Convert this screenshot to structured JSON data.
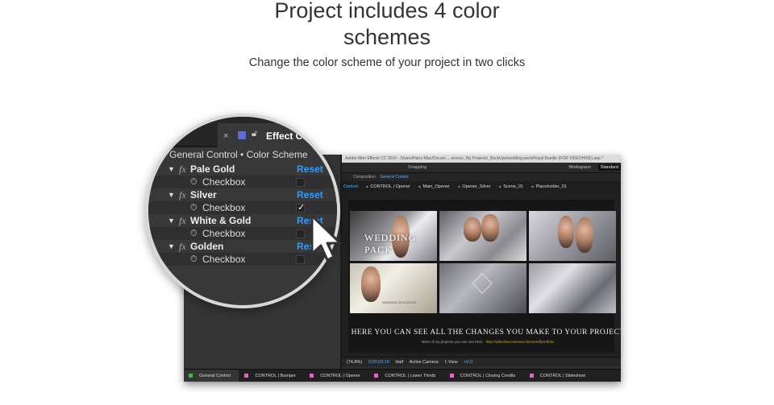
{
  "header": {
    "title_line1": "Project includes 4 color",
    "title_line2": "schemes",
    "subtitle": "Change the color scheme of your project in two clicks"
  },
  "app": {
    "window_title": "Adobe After Effects CC 2014 - /Users/Harry-Mac/Docum ... erence_My Projects/_BackUps/wedding pack/Royal Bundle (FOR VIDEOHIVE).aep *",
    "snapping_label": "Snapping",
    "workspace_label": "Workspace:",
    "workspace_value": "Standard",
    "composition_tab": "Composition",
    "composition_name": "General Control",
    "breadcrumbs": [
      "Control",
      "CONTROL | Opener",
      "Main_Opener",
      "Opener_Silver",
      "Scene_01",
      "Placeholder_01"
    ],
    "preview": {
      "tile1_text": "WEDDING PACK",
      "tile4_text": "WEDDING INVITATION",
      "headline": "HERE YOU CAN SEE ALL THE CHANGES YOU MAKE TO YOUR PROJECT",
      "more_text": "More of my projects you can see here:",
      "more_url": "http://videohive.net/user/Jarvisred/portfolio"
    },
    "footer": {
      "zoom": "(74,8%)",
      "timecode": "0;00;03;15",
      "resolution": "Half",
      "camera": "Active Camera",
      "view": "1 View",
      "exposure": "+0,0"
    },
    "timeline_tabs": [
      {
        "label": "General Control",
        "color": "#4caf50"
      },
      {
        "label": "CONTROL | Bumper",
        "color": "#e066c0"
      },
      {
        "label": "CONTROL | Opener",
        "color": "#e066c0"
      },
      {
        "label": "CONTROL | Lower Thirds",
        "color": "#e066c0"
      },
      {
        "label": "CONTROL | Closing Credits",
        "color": "#e066c0"
      },
      {
        "label": "CONTROL | Slideshow",
        "color": "#e066c0"
      }
    ]
  },
  "effects_panel": {
    "tab_partial": "ect",
    "tab_label": "Effect Controls",
    "tab_swatch_color": "#5b6bd8",
    "heading": "General Control • Color Scheme",
    "effects": [
      {
        "name": "Pale Gold",
        "reset": "Reset",
        "checkbox_label": "Checkbox",
        "checked": false
      },
      {
        "name": "Silver",
        "reset": "Reset",
        "checkbox_label": "Checkbox",
        "checked": true
      },
      {
        "name": "White & Gold",
        "reset": "Reset",
        "checkbox_label": "Checkbox",
        "checked": false
      },
      {
        "name": "Golden",
        "reset": "Reset",
        "checkbox_label": "Checkbox",
        "checked": false
      }
    ]
  },
  "icons": {
    "fx": "fx",
    "stopwatch": "stopwatch-icon",
    "expand": "triangle-down-icon",
    "cursor": "arrow-cursor-icon"
  }
}
